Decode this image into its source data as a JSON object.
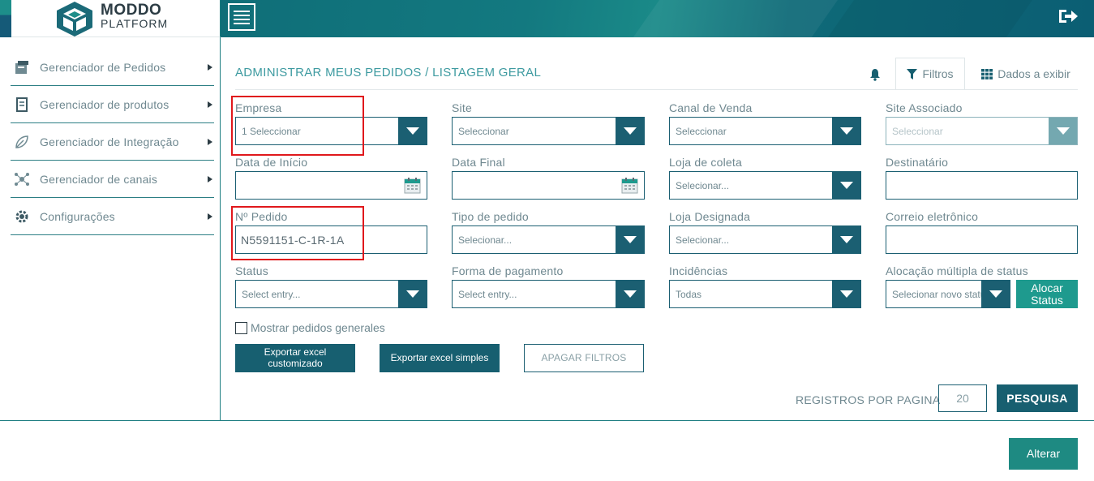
{
  "brand": {
    "name_line1": "MODDO",
    "name_line2": "PLATFORM"
  },
  "sidebar": {
    "items": [
      {
        "label": "Gerenciador de Pedidos",
        "icon": "orders-icon"
      },
      {
        "label": "Gerenciador de produtos",
        "icon": "product-icon"
      },
      {
        "label": "Gerenciador de Integração",
        "icon": "integration-icon"
      },
      {
        "label": "Gerenciador de canais",
        "icon": "channels-icon"
      },
      {
        "label": "Configurações",
        "icon": "gear-icon"
      }
    ]
  },
  "header": {
    "breadcrumb": "ADMINISTRAR MEUS PEDIDOS / LISTAGEM GERAL",
    "tab_filters": "Filtros",
    "tab_data": "Dados a exibir"
  },
  "filters": {
    "empresa": {
      "label": "Empresa",
      "value": "1 Seleccionar"
    },
    "site": {
      "label": "Site",
      "value": "Seleccionar"
    },
    "canal": {
      "label": "Canal de Venda",
      "value": "Seleccionar"
    },
    "site_assoc": {
      "label": "Site Associado",
      "value": "Seleccionar"
    },
    "data_inicio": {
      "label": "Data de Início",
      "value": ""
    },
    "data_final": {
      "label": "Data Final",
      "value": ""
    },
    "loja_coleta": {
      "label": "Loja de coleta",
      "value": "Selecionar..."
    },
    "destinatario": {
      "label": "Destinatário",
      "value": ""
    },
    "pedido": {
      "label": "Nº Pedido",
      "value": "N5591151-C-1R-1A"
    },
    "tipo_pedido": {
      "label": "Tipo de pedido",
      "value": "Selecionar..."
    },
    "loja_designada": {
      "label": "Loja Designada",
      "value": "Selecionar..."
    },
    "correio": {
      "label": "Correio eletrônico",
      "value": ""
    },
    "status": {
      "label": "Status",
      "value": "Select entry..."
    },
    "forma_pagamento": {
      "label": "Forma de pagamento",
      "value": "Select entry..."
    },
    "incidencias": {
      "label": "Incidências",
      "value": "Todas"
    },
    "alocacao": {
      "label": "Alocação múltipla de status",
      "value": "Selecionar novo status"
    }
  },
  "actions": {
    "alocar": "Alocar Status",
    "mostrar": "Mostrar pedidos generales",
    "export_custom": "Exportar excel customizado",
    "export_simple": "Exportar excel simples",
    "clear": "APAGAR FILTROS",
    "registros_label": "REGISTROS POR PAGINA",
    "registros_value": "20",
    "search": "PESQUISA",
    "alterar": "Alterar"
  },
  "colors": {
    "primary": "#175f70",
    "accent": "#1e9a8e",
    "highlight": "#e0181c"
  }
}
